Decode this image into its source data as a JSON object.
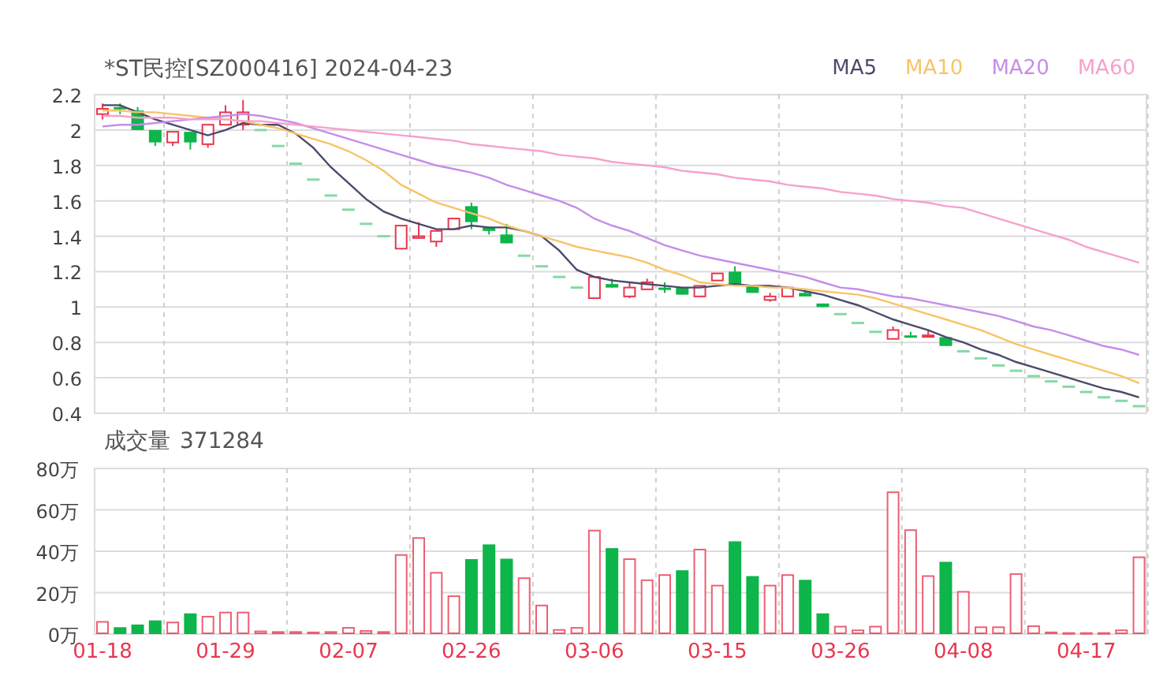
{
  "price_panel": {
    "title": "*ST民控[SZ000416] 2024-04-23",
    "chart_data": {
      "type": "candlestick",
      "grid": true,
      "ylim": [
        0.4,
        2.2
      ],
      "yticks": [
        0.4,
        0.6,
        0.8,
        1,
        1.2,
        1.4,
        1.6,
        1.8,
        2,
        2.2
      ],
      "ohlc": [
        [
          2.09,
          2.15,
          2.06,
          2.12
        ],
        [
          2.13,
          2.15,
          2.09,
          2.12
        ],
        [
          2.11,
          2.13,
          2.0,
          2.0
        ],
        [
          2.0,
          2.0,
          1.91,
          1.93
        ],
        [
          1.93,
          1.99,
          1.91,
          1.99
        ],
        [
          1.99,
          1.99,
          1.89,
          1.93
        ],
        [
          1.92,
          2.03,
          1.9,
          2.03
        ],
        [
          2.03,
          2.14,
          2.03,
          2.1
        ],
        [
          2.03,
          2.17,
          2.0,
          2.1
        ],
        [
          2.0,
          2.0,
          2.0,
          2.0
        ],
        [
          1.91,
          1.91,
          1.91,
          1.91
        ],
        [
          1.81,
          1.81,
          1.81,
          1.81
        ],
        [
          1.72,
          1.72,
          1.72,
          1.72
        ],
        [
          1.63,
          1.63,
          1.63,
          1.63
        ],
        [
          1.55,
          1.55,
          1.55,
          1.55
        ],
        [
          1.47,
          1.47,
          1.47,
          1.47
        ],
        [
          1.4,
          1.4,
          1.4,
          1.4
        ],
        [
          1.33,
          1.46,
          1.33,
          1.46
        ],
        [
          1.39,
          1.48,
          1.39,
          1.4
        ],
        [
          1.37,
          1.43,
          1.34,
          1.43
        ],
        [
          1.44,
          1.5,
          1.44,
          1.5
        ],
        [
          1.57,
          1.59,
          1.44,
          1.48
        ],
        [
          1.45,
          1.45,
          1.41,
          1.43
        ],
        [
          1.41,
          1.47,
          1.36,
          1.36
        ],
        [
          1.29,
          1.29,
          1.29,
          1.29
        ],
        [
          1.23,
          1.23,
          1.23,
          1.23
        ],
        [
          1.17,
          1.17,
          1.17,
          1.17
        ],
        [
          1.11,
          1.11,
          1.11,
          1.11
        ],
        [
          1.05,
          1.17,
          1.05,
          1.17
        ],
        [
          1.13,
          1.16,
          1.11,
          1.11
        ],
        [
          1.06,
          1.14,
          1.05,
          1.11
        ],
        [
          1.1,
          1.16,
          1.1,
          1.14
        ],
        [
          1.11,
          1.14,
          1.08,
          1.11
        ],
        [
          1.11,
          1.11,
          1.07,
          1.07
        ],
        [
          1.06,
          1.12,
          1.06,
          1.12
        ],
        [
          1.15,
          1.19,
          1.15,
          1.19
        ],
        [
          1.2,
          1.23,
          1.13,
          1.13
        ],
        [
          1.12,
          1.12,
          1.08,
          1.08
        ],
        [
          1.04,
          1.08,
          1.03,
          1.06
        ],
        [
          1.06,
          1.11,
          1.06,
          1.11
        ],
        [
          1.08,
          1.1,
          1.06,
          1.06
        ],
        [
          1.02,
          1.02,
          1.0,
          1.0
        ],
        [
          0.96,
          0.96,
          0.96,
          0.96
        ],
        [
          0.91,
          0.91,
          0.91,
          0.91
        ],
        [
          0.86,
          0.86,
          0.86,
          0.86
        ],
        [
          0.82,
          0.89,
          0.82,
          0.87
        ],
        [
          0.84,
          0.86,
          0.84,
          0.84
        ],
        [
          0.835,
          0.87,
          0.835,
          0.84
        ],
        [
          0.83,
          0.83,
          0.78,
          0.78
        ],
        [
          0.75,
          0.75,
          0.75,
          0.75
        ],
        [
          0.71,
          0.71,
          0.71,
          0.71
        ],
        [
          0.67,
          0.67,
          0.67,
          0.67
        ],
        [
          0.64,
          0.64,
          0.64,
          0.64
        ],
        [
          0.61,
          0.61,
          0.61,
          0.61
        ],
        [
          0.58,
          0.58,
          0.58,
          0.58
        ],
        [
          0.55,
          0.55,
          0.55,
          0.55
        ],
        [
          0.52,
          0.52,
          0.52,
          0.52
        ],
        [
          0.49,
          0.49,
          0.49,
          0.49
        ],
        [
          0.47,
          0.47,
          0.47,
          0.47
        ],
        [
          0.44,
          0.44,
          0.44,
          0.44
        ]
      ],
      "series": [
        {
          "name": "MA5",
          "type": "line",
          "color": "#4b4a6b",
          "values": [
            2.14,
            2.14,
            2.1,
            2.06,
            2.03,
            2.0,
            1.97,
            2.0,
            2.04,
            2.03,
            2.03,
            1.98,
            1.9,
            1.79,
            1.7,
            1.61,
            1.54,
            1.5,
            1.47,
            1.44,
            1.44,
            1.46,
            1.45,
            1.45,
            1.43,
            1.4,
            1.32,
            1.21,
            1.17,
            1.15,
            1.14,
            1.13,
            1.12,
            1.11,
            1.11,
            1.12,
            1.13,
            1.12,
            1.12,
            1.11,
            1.09,
            1.07,
            1.04,
            1.01,
            0.97,
            0.93,
            0.9,
            0.87,
            0.83,
            0.8,
            0.76,
            0.73,
            0.69,
            0.66,
            0.63,
            0.6,
            0.57,
            0.54,
            0.52,
            0.49
          ]
        },
        {
          "name": "MA10",
          "type": "line",
          "color": "#f7c467",
          "values": [
            2.11,
            2.11,
            2.1,
            2.1,
            2.09,
            2.08,
            2.07,
            2.06,
            2.05,
            2.03,
            2.01,
            1.98,
            1.95,
            1.92,
            1.88,
            1.83,
            1.77,
            1.69,
            1.64,
            1.59,
            1.56,
            1.53,
            1.5,
            1.46,
            1.43,
            1.4,
            1.37,
            1.34,
            1.32,
            1.3,
            1.28,
            1.25,
            1.21,
            1.18,
            1.14,
            1.13,
            1.12,
            1.12,
            1.11,
            1.11,
            1.1,
            1.09,
            1.08,
            1.07,
            1.05,
            1.02,
            0.99,
            0.96,
            0.93,
            0.9,
            0.87,
            0.83,
            0.79,
            0.76,
            0.73,
            0.7,
            0.67,
            0.64,
            0.61,
            0.57
          ]
        },
        {
          "name": "MA20",
          "type": "line",
          "color": "#c38ee9",
          "values": [
            2.02,
            2.03,
            2.03,
            2.04,
            2.05,
            2.06,
            2.07,
            2.08,
            2.09,
            2.08,
            2.06,
            2.04,
            2.01,
            1.98,
            1.95,
            1.92,
            1.89,
            1.86,
            1.83,
            1.8,
            1.78,
            1.76,
            1.73,
            1.69,
            1.66,
            1.63,
            1.6,
            1.56,
            1.5,
            1.46,
            1.43,
            1.39,
            1.35,
            1.32,
            1.29,
            1.27,
            1.25,
            1.23,
            1.21,
            1.19,
            1.17,
            1.14,
            1.11,
            1.1,
            1.08,
            1.06,
            1.05,
            1.03,
            1.01,
            0.99,
            0.97,
            0.95,
            0.92,
            0.89,
            0.87,
            0.84,
            0.81,
            0.78,
            0.76,
            0.73
          ]
        },
        {
          "name": "MA60",
          "type": "line",
          "color": "#f7a0cc",
          "values": [
            2.08,
            2.08,
            2.07,
            2.07,
            2.07,
            2.06,
            2.06,
            2.06,
            2.05,
            2.05,
            2.04,
            2.03,
            2.02,
            2.01,
            2.0,
            1.99,
            1.98,
            1.97,
            1.96,
            1.95,
            1.94,
            1.92,
            1.91,
            1.9,
            1.89,
            1.88,
            1.86,
            1.85,
            1.84,
            1.82,
            1.81,
            1.8,
            1.79,
            1.77,
            1.76,
            1.75,
            1.73,
            1.72,
            1.71,
            1.69,
            1.68,
            1.67,
            1.65,
            1.64,
            1.63,
            1.61,
            1.6,
            1.59,
            1.57,
            1.56,
            1.53,
            1.5,
            1.47,
            1.44,
            1.41,
            1.38,
            1.34,
            1.31,
            1.28,
            1.25
          ]
        }
      ]
    }
  },
  "volume_panel": {
    "label": "成交量",
    "value": "371284",
    "chart_data": {
      "type": "bar",
      "grid": true,
      "categories": [
        "01-18",
        null,
        null,
        null,
        null,
        null,
        null,
        "01-29",
        null,
        null,
        null,
        null,
        null,
        null,
        "02-07",
        null,
        null,
        null,
        null,
        null,
        null,
        "02-26",
        null,
        null,
        null,
        null,
        null,
        null,
        "03-06",
        null,
        null,
        null,
        null,
        null,
        null,
        "03-15",
        null,
        null,
        null,
        null,
        null,
        null,
        "03-26",
        null,
        null,
        null,
        null,
        null,
        null,
        "04-08",
        null,
        null,
        null,
        null,
        null,
        null,
        "04-17",
        null,
        null,
        null
      ],
      "ylim": [
        0,
        80
      ],
      "yticks": [
        {
          "value": 0,
          "label": "0万"
        },
        {
          "value": 20,
          "label": "20万"
        },
        {
          "value": 40,
          "label": "40万"
        },
        {
          "value": 60,
          "label": "60万"
        },
        {
          "value": 80,
          "label": "80万"
        }
      ],
      "values": [
        5.9,
        3.3,
        4.6,
        6.6,
        5.6,
        10,
        8.4,
        10.4,
        10.4,
        1.3,
        1,
        1,
        0.8,
        1,
        3,
        1.5,
        1,
        38.2,
        46.4,
        29.6,
        18.3,
        36.2,
        43.3,
        36.4,
        27,
        13.8,
        2,
        3,
        50,
        41.5,
        36.2,
        26,
        28.5,
        30.8,
        40.8,
        23.4,
        44.8,
        28,
        23.4,
        28.5,
        26.2,
        10,
        3.6,
        1.8,
        3.6,
        68.5,
        50.2,
        28,
        34.9,
        20.4,
        3.3,
        3.3,
        29,
        3.8,
        0.8,
        0.5,
        0.5,
        0.5,
        1.8,
        37.1
      ]
    }
  }
}
